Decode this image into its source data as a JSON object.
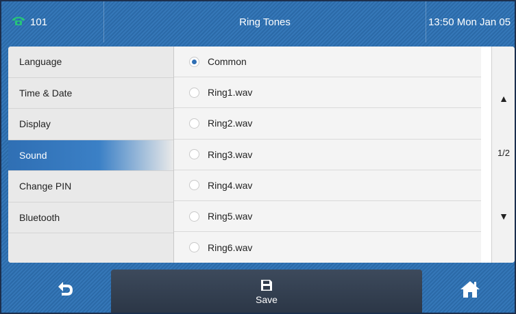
{
  "status_bar": {
    "line": "101",
    "title": "Ring Tones",
    "datetime": "13:50 Mon Jan 05"
  },
  "menu": {
    "items": [
      {
        "label": "Language"
      },
      {
        "label": "Time & Date"
      },
      {
        "label": "Display"
      },
      {
        "label": "Sound",
        "active": true
      },
      {
        "label": "Change PIN"
      },
      {
        "label": "Bluetooth"
      },
      {
        "label": ""
      }
    ]
  },
  "options": {
    "selected": "Common",
    "items": [
      {
        "label": "Common"
      },
      {
        "label": "Ring1.wav"
      },
      {
        "label": "Ring2.wav"
      },
      {
        "label": "Ring3.wav"
      },
      {
        "label": "Ring4.wav"
      },
      {
        "label": "Ring5.wav"
      },
      {
        "label": "Ring6.wav"
      }
    ]
  },
  "scroller": {
    "page": "1/2",
    "up_icon": "triangle-up-icon",
    "down_icon": "triangle-down-icon"
  },
  "softkeys": {
    "back_icon": "back-arrow-icon",
    "save_label": "Save",
    "save_icon": "floppy-disk-icon",
    "home_icon": "home-icon"
  },
  "colors": {
    "accent": "#2f6fb4",
    "bar_background": "#3577b8",
    "phone_icon": "#27c47a"
  }
}
